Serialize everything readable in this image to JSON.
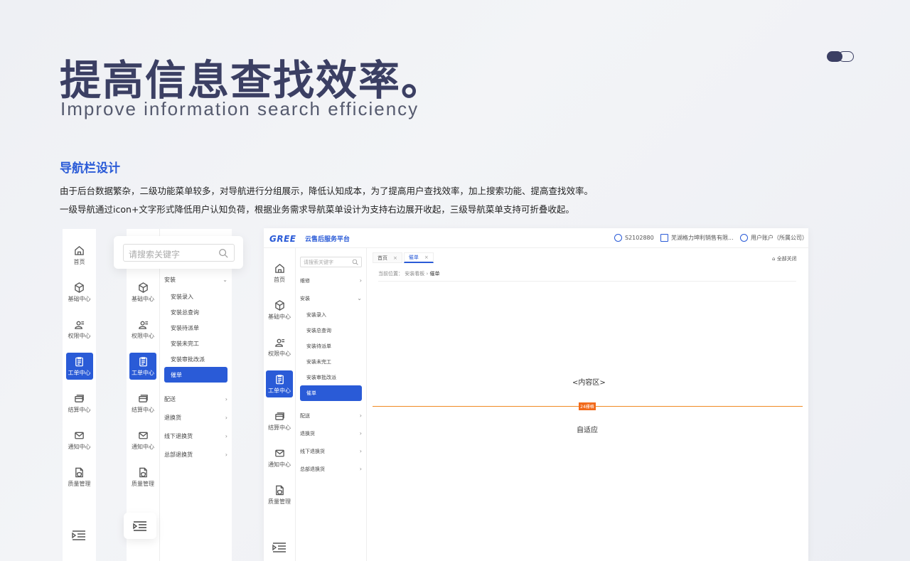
{
  "heading": {
    "title_zh": "提高信息查找效率。",
    "title_en": "Improve information search efficiency"
  },
  "section": {
    "title": "导航栏设计",
    "line1": "由于后台数据繁杂，二级功能菜单较多，对导航进行分组展示，降低认知成本，为了提高用户查找效率，加上搜索功能、提高查找效率。",
    "line2": "一级导航通过icon+文字形式降低用户认知负荷，根据业务需求导航菜单设计为支持右边展开收起，三级导航菜单支持可折叠收起。"
  },
  "rail": {
    "items": [
      {
        "label": "首页",
        "icon": "home-icon"
      },
      {
        "label": "基础中心",
        "icon": "cube-icon"
      },
      {
        "label": "权限中心",
        "icon": "user-card-icon"
      },
      {
        "label": "工单中心",
        "icon": "clipboard-icon"
      },
      {
        "label": "结算中心",
        "icon": "card-icon"
      },
      {
        "label": "通知中心",
        "icon": "mail-icon"
      },
      {
        "label": "质量管理",
        "icon": "file-shield-icon"
      }
    ]
  },
  "search": {
    "placeholder_large": "请搜索关键字",
    "placeholder_small": "请搜索关键字"
  },
  "submenu": {
    "group_repair": "维修",
    "group_install": "安装",
    "install_items": [
      "安装录入",
      "安装总查询",
      "安装待派单",
      "安装未完工",
      "安装审批改派",
      "催单"
    ],
    "other_groups": [
      "配送",
      "退换货",
      "线下退换货",
      "总部退换货"
    ]
  },
  "app": {
    "logo": "GREE",
    "platform": "云售后服务平台",
    "account_id": "S2102880",
    "company": "芜湖格力坤利销售有限...",
    "user": "用户账户（所属公司）",
    "tabs": [
      {
        "label": "首页"
      },
      {
        "label": "催单"
      }
    ],
    "close_all": "全部关闭",
    "breadcrumb_prefix": "当前位置：",
    "breadcrumb_parent": "安装看板",
    "breadcrumb_current": "催单",
    "content_label": "<内容区>",
    "grid_badge": "24栅格",
    "adapt_label": "自适应"
  },
  "colors": {
    "accent": "#2a5bd7",
    "title": "#3b3f63",
    "grid_line": "#f08a24"
  }
}
